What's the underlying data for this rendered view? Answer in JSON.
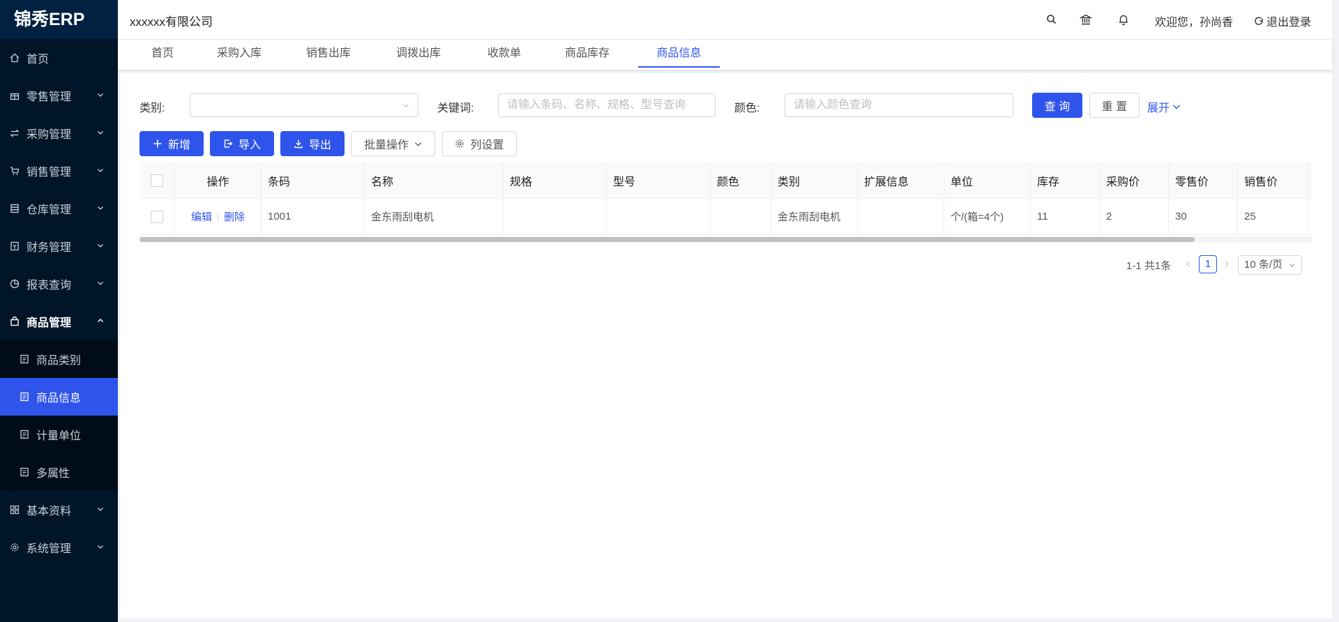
{
  "app": {
    "logo": "锦秀ERP"
  },
  "sidebar": {
    "items": [
      {
        "label": "首页"
      },
      {
        "label": "零售管理"
      },
      {
        "label": "采购管理"
      },
      {
        "label": "销售管理"
      },
      {
        "label": "仓库管理"
      },
      {
        "label": "财务管理"
      },
      {
        "label": "报表查询"
      },
      {
        "label": "商品管理"
      }
    ],
    "sub_items": [
      {
        "label": "商品类别"
      },
      {
        "label": "商品信息"
      },
      {
        "label": "计量单位"
      },
      {
        "label": "多属性"
      }
    ],
    "bottom_items": [
      {
        "label": "基本资料"
      },
      {
        "label": "系统管理"
      }
    ]
  },
  "header": {
    "company": "xxxxxx有限公司",
    "welcome": "欢迎您，孙尚香",
    "logout": "退出登录"
  },
  "tabs": [
    {
      "label": "首页"
    },
    {
      "label": "采购入库"
    },
    {
      "label": "销售出库"
    },
    {
      "label": "调拨出库"
    },
    {
      "label": "收款单"
    },
    {
      "label": "商品库存"
    },
    {
      "label": "商品信息"
    }
  ],
  "search": {
    "category_label": "类别:",
    "keyword_label": "关键词:",
    "keyword_placeholder": "请输入条码、名称、规格、型号查询",
    "color_label": "颜色:",
    "color_placeholder": "请输入颜色查询",
    "query": "查 询",
    "reset": "重 置",
    "expand": "展开"
  },
  "toolbar": {
    "add": "新增",
    "import": "导入",
    "export": "导出",
    "batch": "批量操作",
    "columns": "列设置"
  },
  "table": {
    "headers": [
      "操作",
      "条码",
      "名称",
      "规格",
      "型号",
      "颜色",
      "类别",
      "扩展信息",
      "单位",
      "库存",
      "采购价",
      "零售价",
      "销售价"
    ],
    "rows": [
      {
        "edit": "编辑",
        "delete": "删除",
        "barcode": "1001",
        "name": "金东雨刮电机",
        "spec": "",
        "model": "",
        "color": "",
        "category": "金东雨刮电机",
        "ext": "",
        "unit": "个/(箱=4个)",
        "stock": "11",
        "purchase_price": "2",
        "retail_price": "30",
        "sale_price": "25"
      }
    ]
  },
  "pagination": {
    "total": "1-1 共1条",
    "current": "1",
    "page_size": "10 条/页"
  },
  "colors": {
    "accent": "#2f54eb",
    "sidebar_bg": "#011528"
  }
}
